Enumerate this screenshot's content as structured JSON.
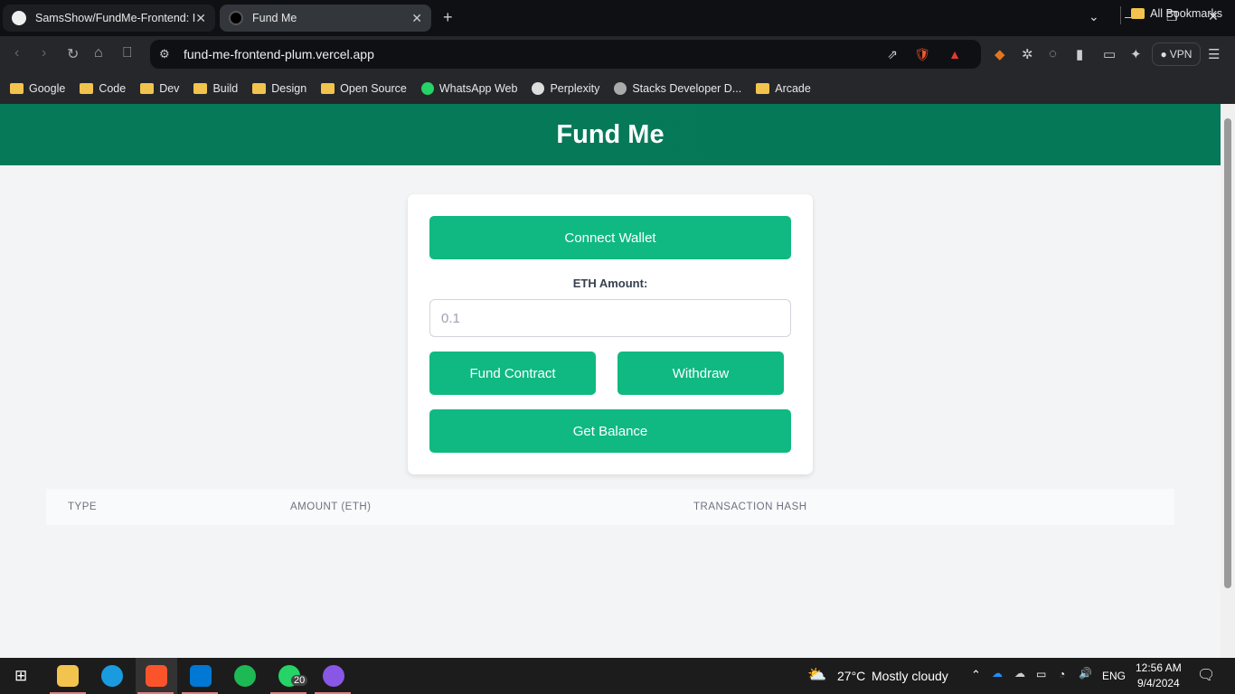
{
  "browser": {
    "tabs": [
      {
        "title": "SamsShow/FundMe-Frontend: I"
      },
      {
        "title": "Fund Me"
      }
    ],
    "url": "fund-me-frontend-plum.vercel.app",
    "vpn_label": "VPN",
    "bookmarks": [
      {
        "label": "Google",
        "icon": "folder-icon"
      },
      {
        "label": "Code",
        "icon": "folder-icon"
      },
      {
        "label": "Dev",
        "icon": "folder-icon"
      },
      {
        "label": "Build",
        "icon": "folder-icon"
      },
      {
        "label": "Design",
        "icon": "folder-icon"
      },
      {
        "label": "Open Source",
        "icon": "folder-icon"
      },
      {
        "label": "WhatsApp Web",
        "icon": "whatsapp-icon"
      },
      {
        "label": "Perplexity",
        "icon": "perplexity-icon"
      },
      {
        "label": "Stacks Developer D...",
        "icon": "stacks-icon"
      },
      {
        "label": "Arcade",
        "icon": "folder-icon"
      }
    ],
    "all_bookmarks": "All Bookmarks"
  },
  "app": {
    "title": "Fund Me",
    "connect_label": "Connect Wallet",
    "eth_label": "ETH Amount:",
    "amount_placeholder": "0.1",
    "fund_label": "Fund Contract",
    "withdraw_label": "Withdraw",
    "balance_label": "Get Balance",
    "table_headers": [
      "TYPE",
      "AMOUNT (ETH)",
      "TRANSACTION HASH"
    ],
    "accent": "#10b981",
    "header_color": "#047857"
  },
  "taskbar": {
    "temp": "27°C",
    "weather": "Mostly cloudy",
    "lang": "ENG",
    "time": "12:56 AM",
    "date": "9/4/2024",
    "whatsapp_badge": "20"
  }
}
